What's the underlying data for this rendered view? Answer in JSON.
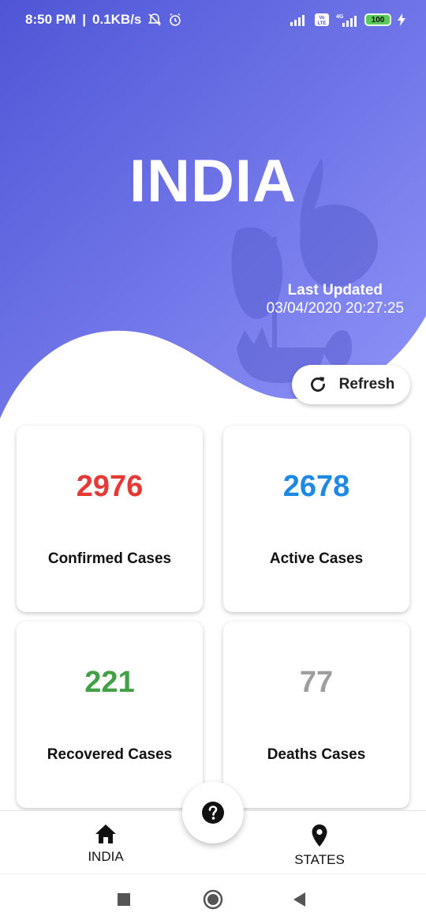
{
  "status_bar": {
    "time": "8:50 PM",
    "speed": "0.1KB/s",
    "icons": [
      "bell-off-icon",
      "alarm-icon",
      "signal-icon",
      "volte-icon",
      "4g-signal-icon",
      "charging-icon"
    ],
    "battery": "100",
    "volte_label": "Vo LTE",
    "network_label": "4G"
  },
  "hero": {
    "title": "INDIA",
    "last_updated_label": "Last Updated",
    "last_updated_time": "03/04/2020 20:27:25",
    "gradient": [
      "#5058d8",
      "#8a8ff7"
    ]
  },
  "refresh_button": {
    "label": "Refresh",
    "icon": "refresh-icon"
  },
  "stats": [
    {
      "value": "2976",
      "label": "Confirmed Cases",
      "color": "#e53935"
    },
    {
      "value": "2678",
      "label": "Active Cases",
      "color": "#1e88e5"
    },
    {
      "value": "221",
      "label": "Recovered Cases",
      "color": "#43a047"
    },
    {
      "value": "77",
      "label": "Deaths Cases",
      "color": "#9e9e9e"
    }
  ],
  "help_button": {
    "icon": "help-icon"
  },
  "bottom_nav": {
    "india_label": "INDIA",
    "states_label": "STATES",
    "india_icon": "home-icon",
    "states_icon": "map-pin-icon"
  },
  "system_nav": {
    "icons": [
      "recents-square-icon",
      "home-circle-icon",
      "back-triangle-icon"
    ]
  }
}
